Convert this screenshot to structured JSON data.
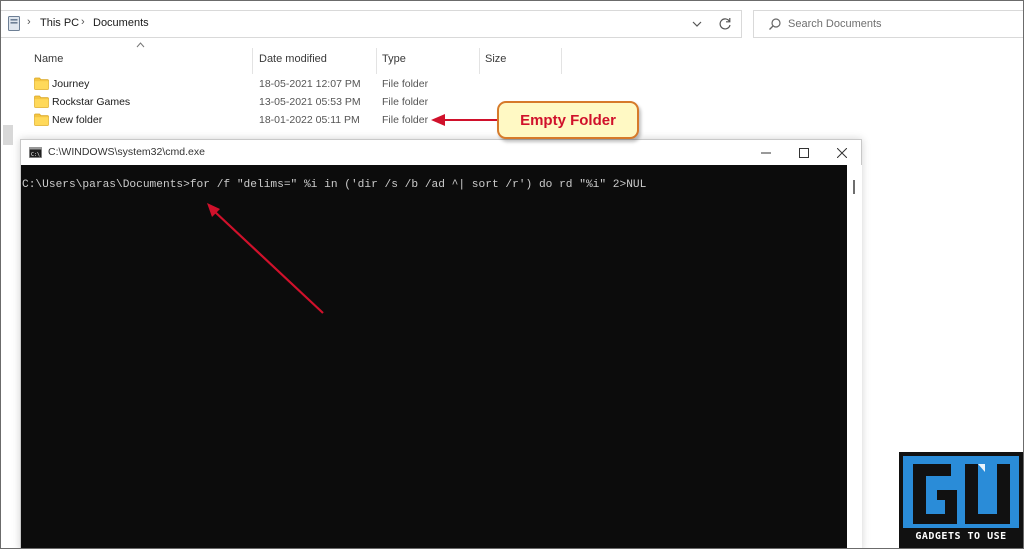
{
  "explorer": {
    "breadcrumb": [
      "This PC",
      "Documents"
    ],
    "search_placeholder": "Search Documents",
    "columns": {
      "name": "Name",
      "date": "Date modified",
      "type": "Type",
      "size": "Size"
    },
    "rows": [
      {
        "name": "Journey",
        "date": "18-05-2021 12:07 PM",
        "type": "File folder"
      },
      {
        "name": "Rockstar Games",
        "date": "13-05-2021 05:53 PM",
        "type": "File folder"
      },
      {
        "name": "New folder",
        "date": "18-01-2022 05:11 PM",
        "type": "File folder"
      }
    ]
  },
  "callout": {
    "text": "Empty Folder"
  },
  "cmd": {
    "title": "C:\\WINDOWS\\system32\\cmd.exe",
    "command_line": "C:\\Users\\paras\\Documents>for /f \"delims=\" %i in ('dir /s /b /ad ^| sort /r') do rd \"%i\" 2>NUL"
  },
  "watermark": {
    "text": "GADGETS TO USE"
  },
  "colors": {
    "folder": "#f4c542",
    "console_bg": "#0c0c0c",
    "console_text": "#cccccc",
    "callout_fill": "#fff9c4",
    "callout_text": "#d0112b",
    "arrow": "#d0112b",
    "logo_blue": "#2a8cd8"
  },
  "icons": {
    "pc": "this-pc-icon",
    "folder": "folder-icon",
    "search": "search-icon",
    "refresh": "refresh-icon",
    "cmd": "command-prompt-icon"
  }
}
